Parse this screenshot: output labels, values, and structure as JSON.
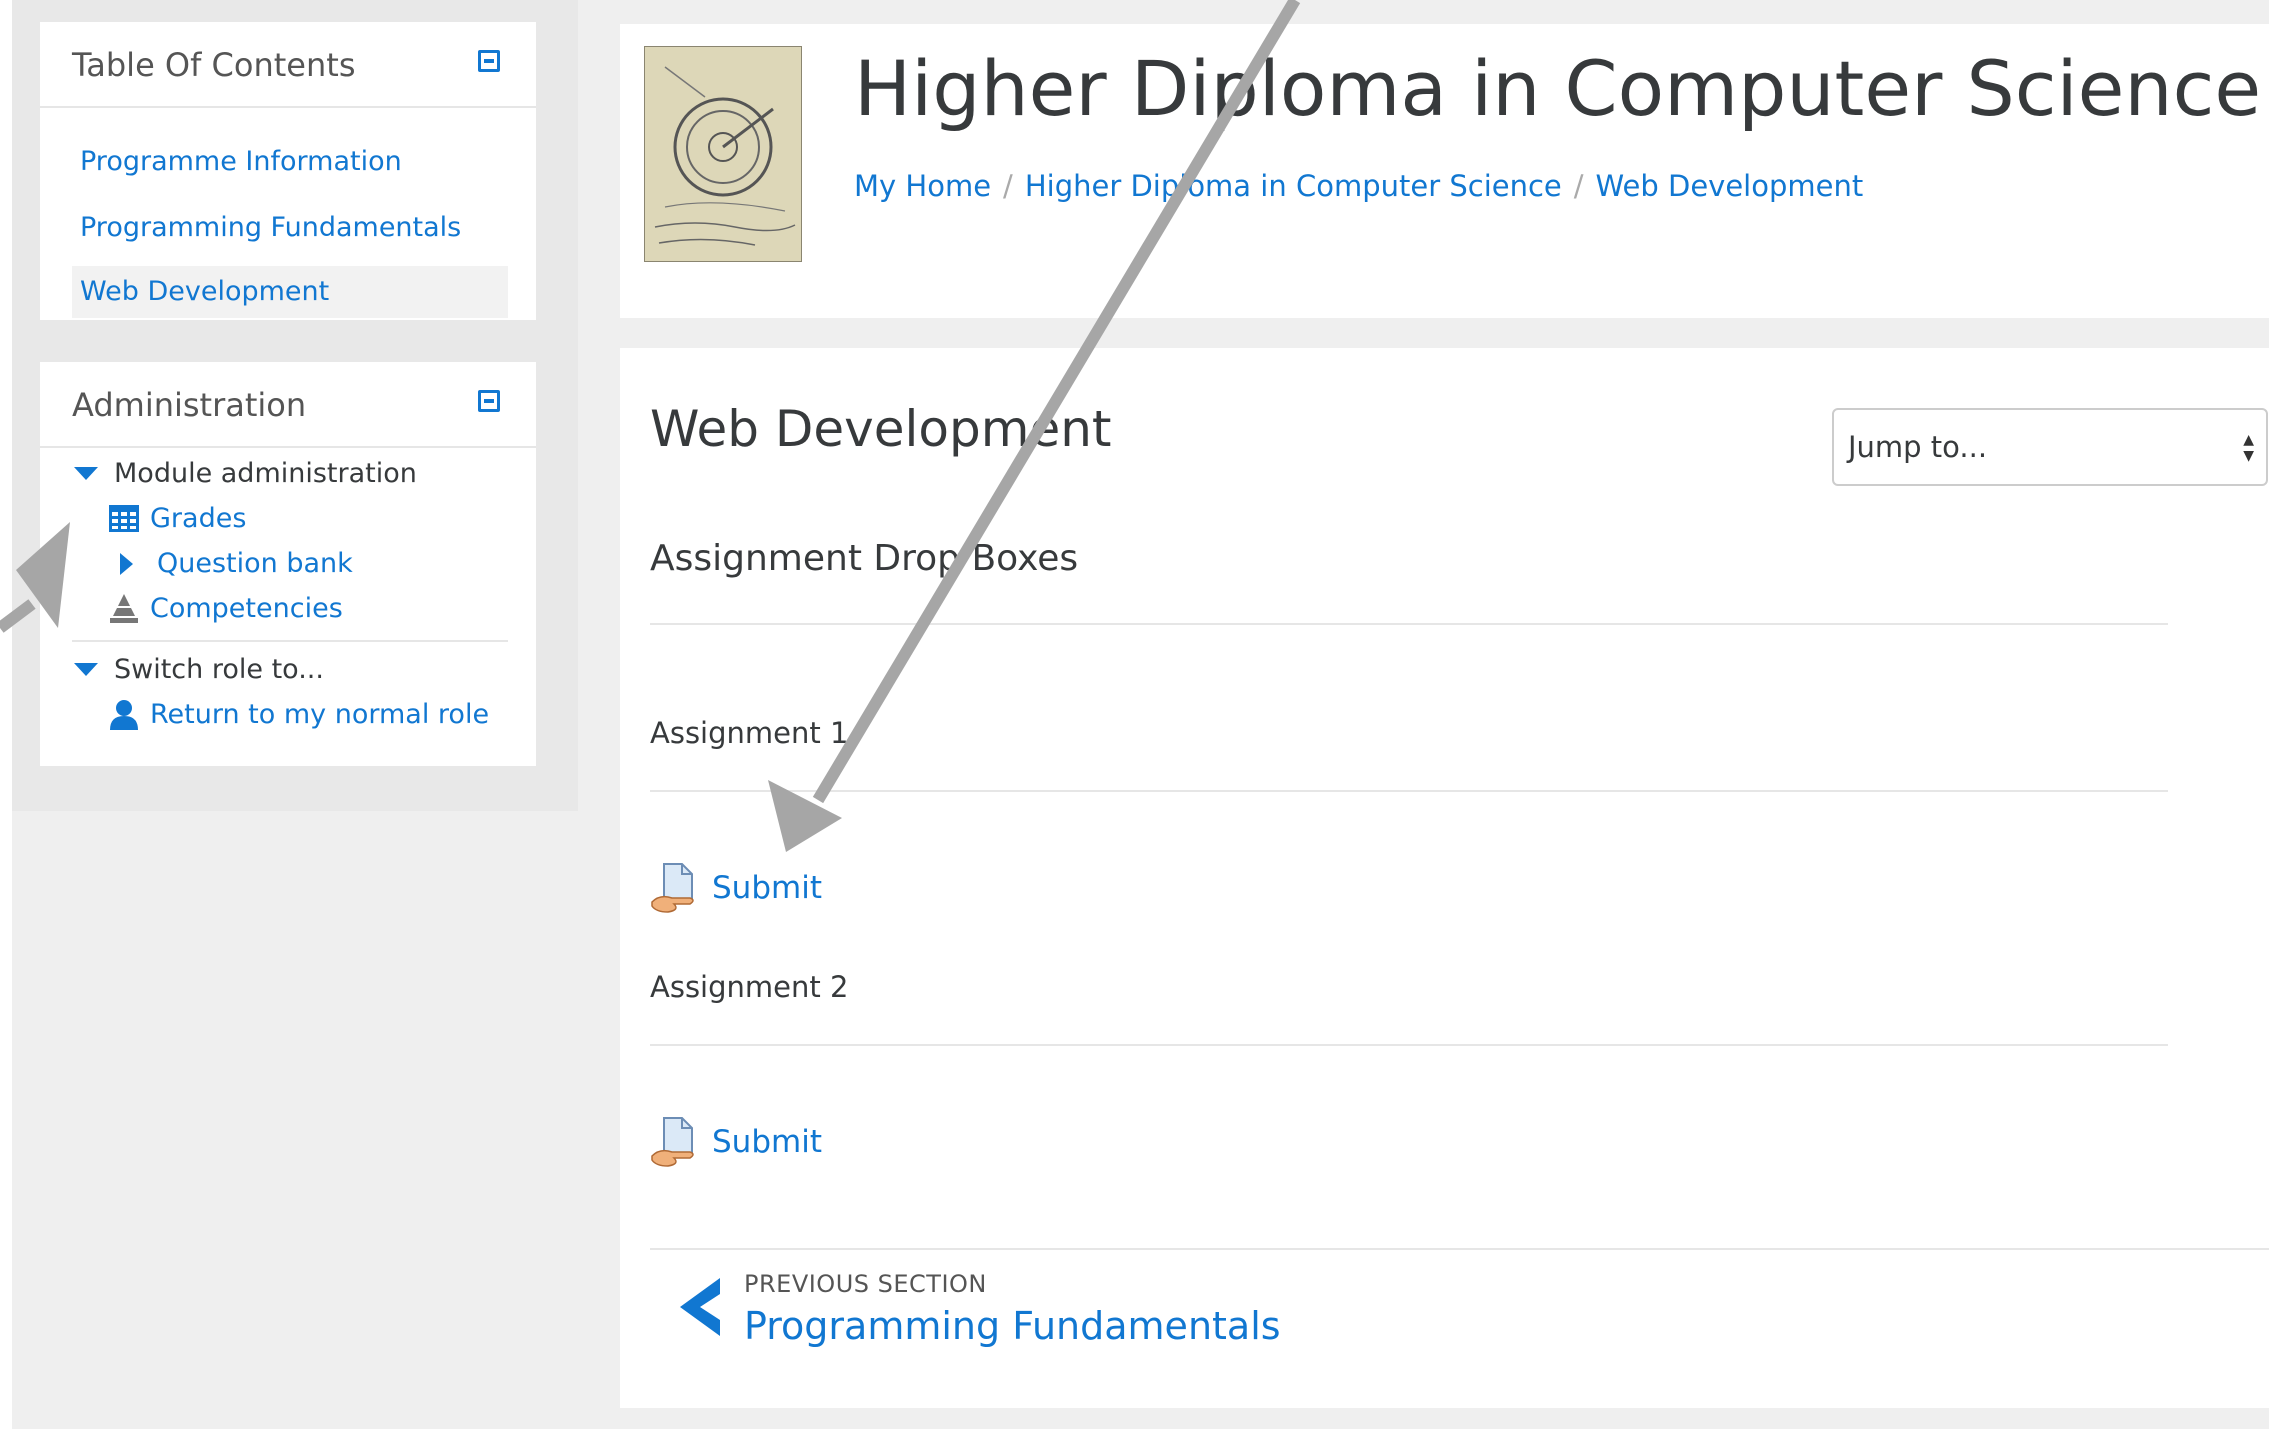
{
  "toc": {
    "title": "Table Of Contents",
    "items": [
      {
        "label": "Programme Information"
      },
      {
        "label": "Programming Fundamentals"
      },
      {
        "label": "Web Development"
      }
    ]
  },
  "admin": {
    "title": "Administration",
    "module_admin": "Module administration",
    "grades": "Grades",
    "question_bank": "Question bank",
    "competencies": "Competencies",
    "switch_role": "Switch role to...",
    "return_role": "Return to my normal role"
  },
  "header": {
    "title": "Higher Diploma in Computer Science",
    "breadcrumb": [
      "My Home",
      "Higher Diploma in Computer Science",
      "Web Development"
    ],
    "separator": "/"
  },
  "main": {
    "section_title": "Web Development",
    "jump_label": "Jump to...",
    "subheading": "Assignment Drop Boxes",
    "assignments": [
      {
        "label": "Assignment 1",
        "submit": "Submit"
      },
      {
        "label": "Assignment 2",
        "submit": "Submit"
      }
    ],
    "prev_small": "PREVIOUS SECTION",
    "prev_link": "Programming Fundamentals"
  },
  "colors": {
    "link": "#1177d1",
    "annotation_arrow": "#a6a6a6"
  },
  "icons": [
    "collapse-icon",
    "grades-table-icon",
    "chevron-right-icon",
    "competencies-icon",
    "user-icon",
    "assignment-submit-icon",
    "chevron-left-icon"
  ]
}
